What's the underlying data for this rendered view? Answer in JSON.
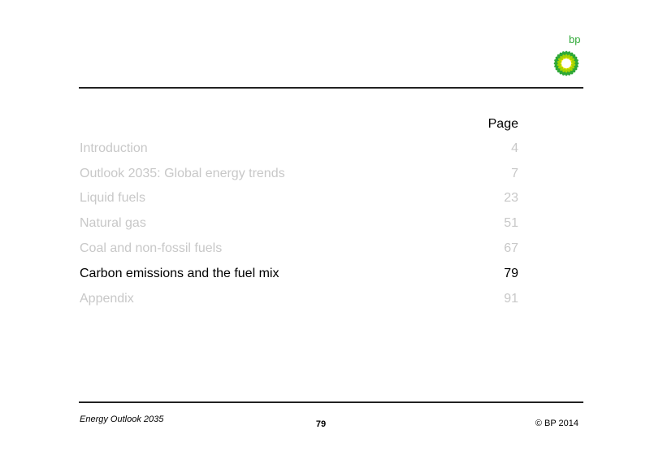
{
  "logo": {
    "text": "bp",
    "colors": {
      "outer": "#2ea836",
      "middle": "#a8d400",
      "inner": "#ffe600",
      "center": "#ffffff"
    }
  },
  "toc": {
    "header": "Page",
    "items": [
      {
        "title": "Introduction",
        "page": "4",
        "active": false
      },
      {
        "title": "Outlook 2035: Global energy trends",
        "page": "7",
        "active": false
      },
      {
        "title": "Liquid fuels",
        "page": "23",
        "active": false
      },
      {
        "title": "Natural gas",
        "page": "51",
        "active": false
      },
      {
        "title": "Coal and non-fossil fuels",
        "page": "67",
        "active": false
      },
      {
        "title": "Carbon emissions and the fuel mix",
        "page": "79",
        "active": true
      },
      {
        "title": "Appendix",
        "page": "91",
        "active": false
      }
    ]
  },
  "footer": {
    "title": "Energy Outlook 2035",
    "page_number": "79",
    "copyright": "© BP 2014"
  }
}
